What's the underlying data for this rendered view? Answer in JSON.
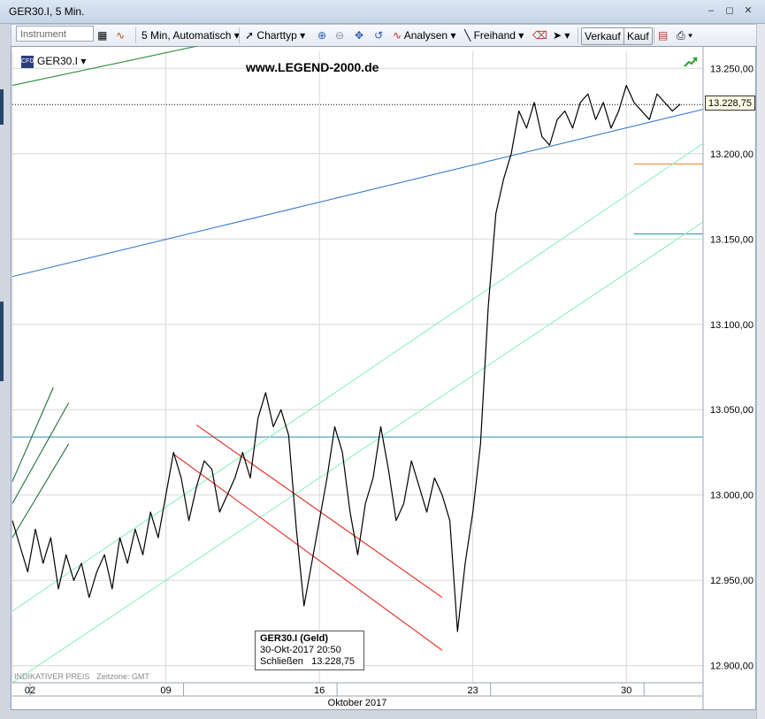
{
  "window": {
    "title": "GER30.I, 5 Min.",
    "controls": [
      "minimize-icon",
      "maximize-icon",
      "close-icon"
    ]
  },
  "toolbar": {
    "instrument_placeholder": "Instrument",
    "interval": "5 Min,",
    "mode": "Automatisch",
    "charttype": "Charttyp",
    "analysen": "Analysen",
    "freihand": "Freihand",
    "verkauf": "Verkauf",
    "kauf": "Kauf"
  },
  "chart_header": {
    "instrument": "GER30.I",
    "watermark": "www.LEGEND-2000.de"
  },
  "last_price_label": "13.228,75",
  "tooltip": {
    "title": "GER30.I (Geld)",
    "date": "30-Okt-2017 20:50",
    "close_label": "Schließen",
    "close_value": "13.228,75"
  },
  "footer": {
    "price_type": "INDIKATIVER PREIS",
    "timezone": "Zeitzone: GMT"
  },
  "colors": {
    "price": "#000000",
    "blue_line": "#3a78c9",
    "teal_line": "#2a8fb0",
    "green_channel": "#8ef0c0",
    "red_channel": "#e0281e",
    "dark_green": "#2e8b3a",
    "orange": "#e87b2a"
  },
  "chart_data": {
    "type": "line",
    "title": "",
    "xlabel": "Oktober 2017",
    "ylabel": "",
    "ylim": [
      12890,
      13260
    ],
    "yticks": [
      12900,
      12950,
      13000,
      13050,
      13100,
      13150,
      13200,
      13250
    ],
    "ytick_labels": [
      "12.900,00",
      "12.950,00",
      "13.000,00",
      "13.050,00",
      "13.100,00",
      "13.150,00",
      "13.200,00",
      "13.250,00"
    ],
    "xlim": [
      0,
      27
    ],
    "xticks": [
      0,
      6,
      12,
      18,
      24
    ],
    "xtick_labels": [
      "02",
      "09",
      "16",
      "23",
      "30"
    ],
    "x_unit": "trading day index (02 Okt = 0)",
    "grid": true,
    "series": [
      {
        "values_x": [
          0,
          0.3,
          0.6,
          0.9,
          1.2,
          1.5,
          1.8,
          2.1,
          2.4,
          2.7,
          3.0,
          3.3,
          3.6,
          3.9,
          4.2,
          4.5,
          4.8,
          5.1,
          5.4,
          5.7,
          6.0,
          6.3,
          6.6,
          6.9,
          7.2,
          7.5,
          7.8,
          8.1,
          8.4,
          8.7,
          9.0,
          9.3,
          9.6,
          9.9,
          10.2,
          10.5,
          10.8,
          11.1,
          11.4,
          11.7,
          12.0,
          12.3,
          12.6,
          12.9,
          13.2,
          13.5,
          13.8,
          14.1,
          14.4,
          14.7,
          15.0,
          15.3,
          15.6,
          15.9,
          16.2,
          16.5,
          16.8,
          17.1,
          17.4,
          17.7,
          18.0,
          18.3,
          18.6,
          18.9,
          19.2,
          19.5,
          19.8,
          20.1,
          20.4,
          20.7,
          21.0,
          21.3,
          21.6,
          21.9,
          22.2,
          22.5,
          22.8,
          23.1,
          23.4,
          23.7,
          24.0,
          24.3,
          24.6,
          24.9,
          25.2,
          25.5,
          25.8,
          26.1
        ],
        "values": [
          12985,
          12970,
          12955,
          12980,
          12960,
          12975,
          12945,
          12965,
          12950,
          12960,
          12940,
          12955,
          12965,
          12945,
          12975,
          12960,
          12980,
          12965,
          12990,
          12975,
          13000,
          13025,
          13010,
          12985,
          13005,
          13020,
          13015,
          12990,
          13000,
          13010,
          13025,
          13010,
          13045,
          13060,
          13040,
          13050,
          13035,
          12980,
          12935,
          12960,
          12985,
          13010,
          13040,
          13025,
          12990,
          12965,
          12995,
          13010,
          13040,
          13015,
          12985,
          12995,
          13020,
          13005,
          12990,
          13010,
          13000,
          12985,
          12920,
          12960,
          12990,
          13030,
          13110,
          13165,
          13185,
          13200,
          13225,
          13215,
          13230,
          13210,
          13205,
          13220,
          13225,
          13215,
          13230,
          13235,
          13220,
          13230,
          13215,
          13225,
          13240,
          13230,
          13225,
          13220,
          13235,
          13230,
          13225,
          13229
        ]
      }
    ],
    "horizontal_lines": [
      {
        "value": 13228.75,
        "style": "dotted",
        "color": "#000000"
      },
      {
        "value": 13034,
        "color": "#2a8fb0"
      },
      {
        "value": 13194,
        "color": "#e87b2a",
        "from_x": 24.3
      },
      {
        "value": 13153,
        "color": "#2a8fb0",
        "from_x": 24.3
      }
    ],
    "trend_lines": [
      {
        "x": [
          0,
          27
        ],
        "y": [
          13128,
          13226
        ],
        "color": "#3a78c9"
      },
      {
        "x": [
          0,
          27
        ],
        "y": [
          12932,
          13206
        ],
        "color": "#8ef0c0"
      },
      {
        "x": [
          0,
          27
        ],
        "y": [
          12890,
          13160
        ],
        "color": "#8ef0c0"
      },
      {
        "x": [
          7.2,
          16.8
        ],
        "y": [
          13041,
          12940
        ],
        "color": "#e0281e"
      },
      {
        "x": [
          6.3,
          16.8
        ],
        "y": [
          13024,
          12909
        ],
        "color": "#e0281e"
      },
      {
        "x": [
          0,
          7.2
        ],
        "y": [
          13240,
          13263
        ],
        "color": "#2e8b3a"
      },
      {
        "x": [
          0,
          1.6
        ],
        "y": [
          13008,
          13063
        ],
        "color": "#1f6f3a"
      },
      {
        "x": [
          0,
          2.2
        ],
        "y": [
          12995,
          13054
        ],
        "color": "#1f6f3a"
      },
      {
        "x": [
          0,
          2.2
        ],
        "y": [
          12975,
          13030
        ],
        "color": "#1f6f3a"
      }
    ]
  }
}
